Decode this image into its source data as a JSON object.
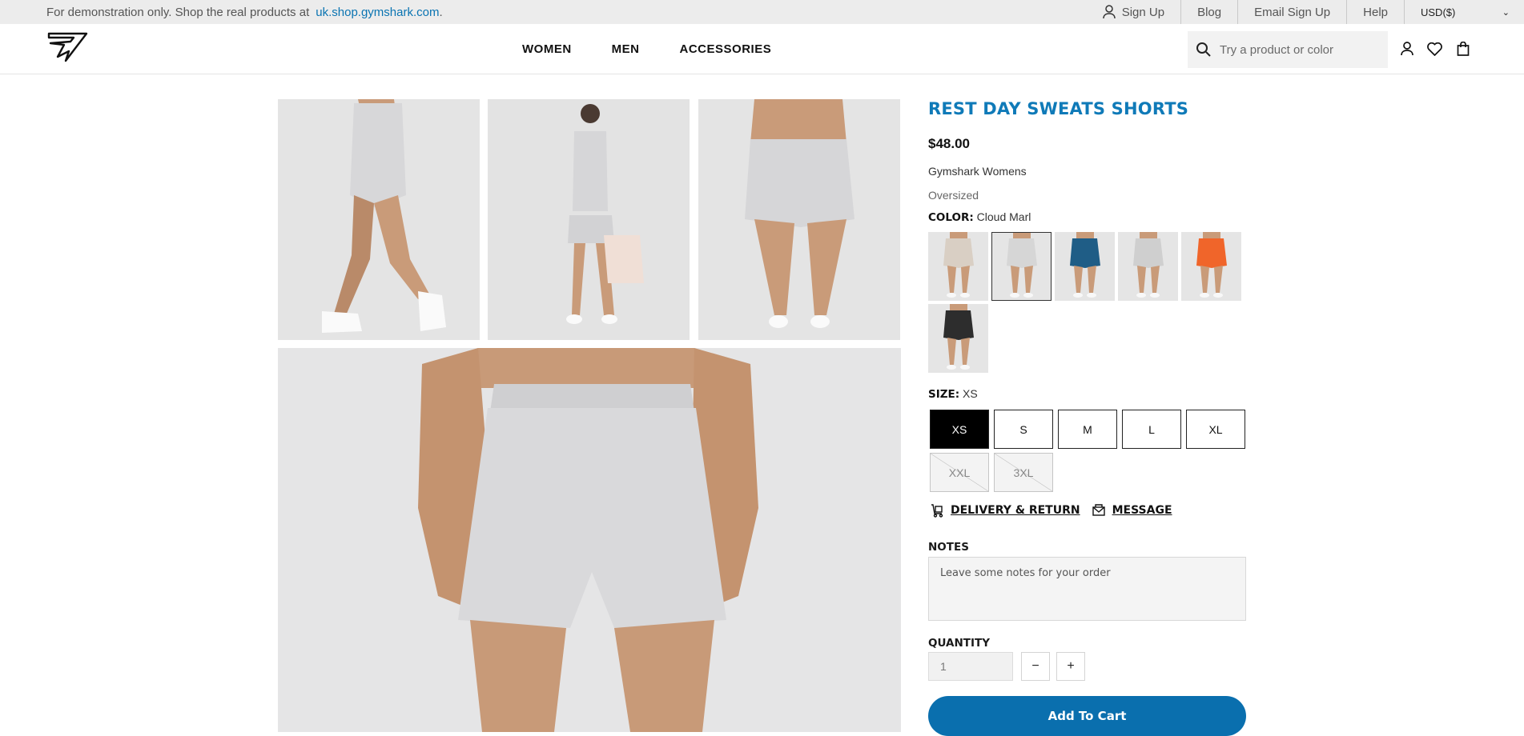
{
  "topbar": {
    "promo_text": "For demonstration only. Shop the real products at",
    "promo_link": "uk.shop.gymshark.com",
    "promo_end": ".",
    "links": [
      "Sign Up",
      "Blog",
      "Email Sign Up",
      "Help"
    ],
    "currency": "USD($)"
  },
  "header": {
    "nav": [
      "WOMEN",
      "MEN",
      "ACCESSORIES"
    ],
    "search_placeholder": "Try a product or color"
  },
  "product": {
    "title": "REST DAY SWEATS SHORTS",
    "price": "$48.00",
    "brand": "Gymshark Womens",
    "fit": "Oversized",
    "color_label": "COLOR:",
    "color_value": "Cloud Marl",
    "swatch_colors": [
      "#d9cfc4",
      "#d6d6d6",
      "#1f5d86",
      "#cfcfcf",
      "#f0652a",
      "#2d2d2d"
    ],
    "selected_swatch": 1,
    "size_label": "SIZE:",
    "size_value": "XS",
    "sizes": [
      "XS",
      "S",
      "M",
      "L",
      "XL",
      "XXL",
      "3XL"
    ],
    "delivery_link": "DELIVERY & RETURN",
    "message_link": "MESSAGE",
    "notes_label": "NOTES",
    "notes_placeholder": "Leave some notes for your order",
    "quantity_label": "QUANTITY",
    "quantity_value": "1",
    "minus": "−",
    "plus": "+",
    "add_to_cart": "Add To Cart"
  }
}
